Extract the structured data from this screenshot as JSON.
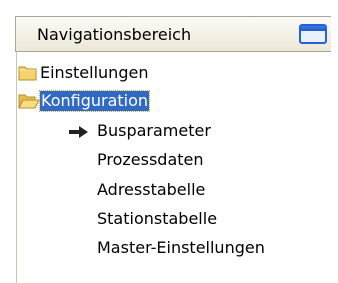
{
  "header": {
    "title": "Navigationsbereich",
    "window_button_icon": "window-icon"
  },
  "tree": {
    "folders": [
      {
        "label": "Einstellungen",
        "icon": "folder-closed-icon",
        "selected": false
      },
      {
        "label": "Konfiguration",
        "icon": "folder-open-icon",
        "selected": true
      }
    ],
    "children": [
      {
        "label": "Busparameter",
        "icon": "arrow-right-icon",
        "current": true
      },
      {
        "label": "Prozessdaten"
      },
      {
        "label": "Adresstabelle"
      },
      {
        "label": "Stationstabelle"
      },
      {
        "label": "Master-Einstellungen"
      }
    ]
  },
  "colors": {
    "selection": "#316ac5",
    "folder": "#f3d36f",
    "title_button": "#2561d8"
  }
}
